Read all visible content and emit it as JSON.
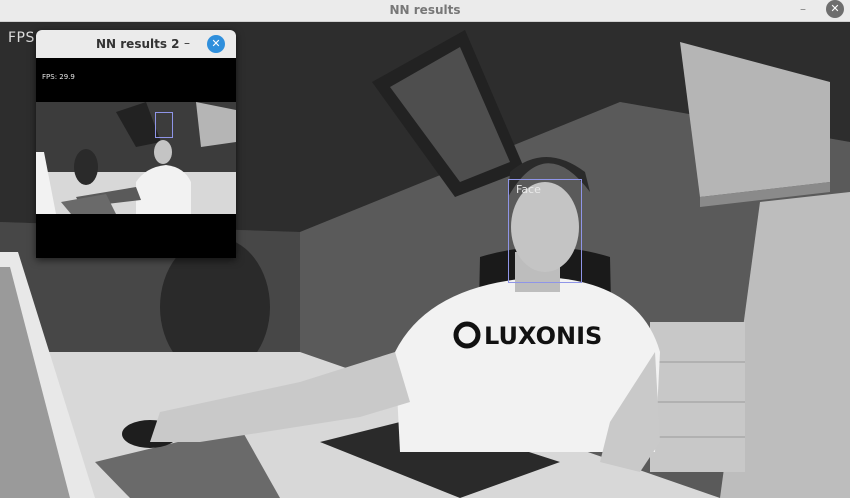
{
  "main_window": {
    "title": "NN results",
    "minimize_glyph": "–",
    "close_glyph": "✕"
  },
  "main_view": {
    "fps_label": "FPS",
    "detection_label": "Face",
    "shirt_logo": "LUXONIS"
  },
  "sub_window": {
    "title": "NN results 2",
    "minimize_glyph": "–",
    "close_glyph": "✕",
    "fps_text": "FPS: 29.9"
  },
  "colors": {
    "detection_box": "#8f95e8",
    "titlebar_bg": "#ebebeb",
    "sub_close_button": "#2f8fdc"
  }
}
